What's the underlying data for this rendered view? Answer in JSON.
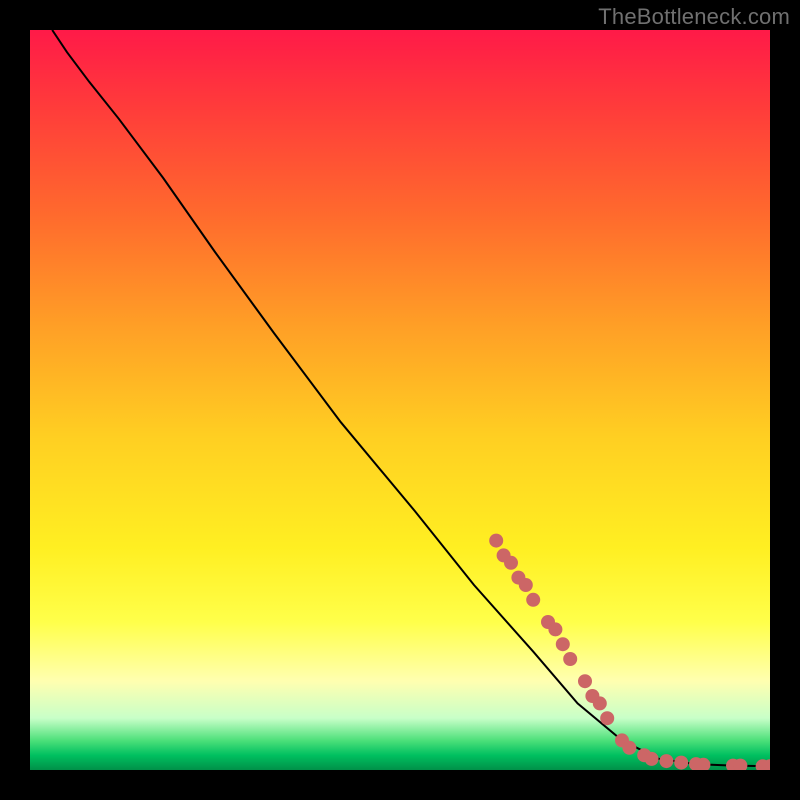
{
  "watermark": "TheBottleneck.com",
  "chart_data": {
    "type": "line",
    "xlabel": "",
    "ylabel": "",
    "xlim": [
      0,
      100
    ],
    "ylim": [
      0,
      100
    ],
    "grid": false,
    "legend": false,
    "curve": [
      {
        "x": 3,
        "y": 100
      },
      {
        "x": 5,
        "y": 97
      },
      {
        "x": 8,
        "y": 93
      },
      {
        "x": 12,
        "y": 88
      },
      {
        "x": 18,
        "y": 80
      },
      {
        "x": 25,
        "y": 70
      },
      {
        "x": 33,
        "y": 59
      },
      {
        "x": 42,
        "y": 47
      },
      {
        "x": 52,
        "y": 35
      },
      {
        "x": 60,
        "y": 25
      },
      {
        "x": 68,
        "y": 16
      },
      {
        "x": 74,
        "y": 9
      },
      {
        "x": 80,
        "y": 4
      },
      {
        "x": 85,
        "y": 1.5
      },
      {
        "x": 90,
        "y": 0.8
      },
      {
        "x": 95,
        "y": 0.6
      },
      {
        "x": 100,
        "y": 0.5
      }
    ],
    "points": [
      {
        "x": 63,
        "y": 31
      },
      {
        "x": 64,
        "y": 29
      },
      {
        "x": 65,
        "y": 28
      },
      {
        "x": 66,
        "y": 26
      },
      {
        "x": 67,
        "y": 25
      },
      {
        "x": 68,
        "y": 23
      },
      {
        "x": 70,
        "y": 20
      },
      {
        "x": 71,
        "y": 19
      },
      {
        "x": 72,
        "y": 17
      },
      {
        "x": 73,
        "y": 15
      },
      {
        "x": 75,
        "y": 12
      },
      {
        "x": 76,
        "y": 10
      },
      {
        "x": 77,
        "y": 9
      },
      {
        "x": 78,
        "y": 7
      },
      {
        "x": 80,
        "y": 4
      },
      {
        "x": 81,
        "y": 3
      },
      {
        "x": 83,
        "y": 2
      },
      {
        "x": 84,
        "y": 1.5
      },
      {
        "x": 86,
        "y": 1.2
      },
      {
        "x": 88,
        "y": 1
      },
      {
        "x": 90,
        "y": 0.8
      },
      {
        "x": 91,
        "y": 0.7
      },
      {
        "x": 95,
        "y": 0.6
      },
      {
        "x": 96,
        "y": 0.6
      },
      {
        "x": 99,
        "y": 0.5
      },
      {
        "x": 100,
        "y": 0.5
      }
    ],
    "curve_color": "#000000",
    "point_color": "#cc6666",
    "point_radius": 7
  }
}
